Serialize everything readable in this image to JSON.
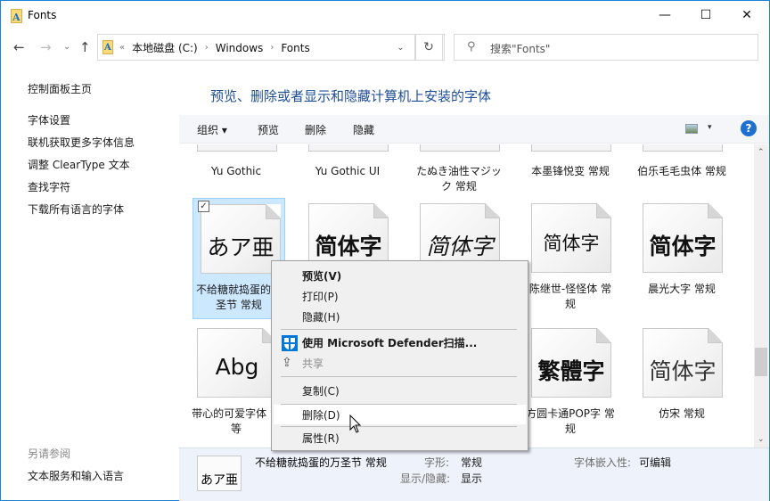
{
  "window": {
    "title": "Fonts",
    "controls": {
      "minimize": "—",
      "maximize": "☐",
      "close": "✕"
    }
  },
  "nav": {
    "back": "←",
    "forward": "→",
    "recent": "⌄",
    "up": "↑",
    "breadcrumb_overflow": "«",
    "breadcrumbs": [
      "本地磁盘 (C:)",
      "Windows",
      "Fonts"
    ],
    "separator": "›",
    "dropdown": "⌄",
    "refresh": "↻",
    "search_placeholder": "搜索\"Fonts\"",
    "search_icon": "⚲"
  },
  "sidebar": {
    "home": "控制面板主页",
    "items": [
      "字体设置",
      "联机获取更多字体信息",
      "调整 ClearType 文本",
      "查找字符",
      "下载所有语言的字体"
    ],
    "see_also_title": "另请参阅",
    "see_also": [
      "文本服务和输入语言"
    ]
  },
  "main": {
    "heading": "预览、删除或者显示和隐藏计算机上安装的字体"
  },
  "toolbar": {
    "organize": "组织 ▾",
    "preview": "预览",
    "delete": "删除",
    "hide": "隐藏",
    "view_dropdown": "▾",
    "help": "?"
  },
  "fonts_row_top": [
    {
      "name": "Yu Gothic"
    },
    {
      "name": "Yu Gothic UI"
    },
    {
      "name": "たぬき油性マジック 常规"
    },
    {
      "name": "本墨锋悦变 常规"
    },
    {
      "name": "伯乐毛毛虫体 常规"
    }
  ],
  "fonts_row_mid": [
    {
      "name": "不给糖就捣蛋的万圣节 常规",
      "sample": "あア亜",
      "selected": true
    },
    {
      "name": "",
      "sample": "简体字"
    },
    {
      "name": "",
      "sample": "简体字"
    },
    {
      "name": "陈继世-怪怪体 常规",
      "sample": "简体字"
    },
    {
      "name": "晨光大字 常规",
      "sample": "简体字"
    }
  ],
  "fonts_row_bot": [
    {
      "name": "带心的可爱字体 中等",
      "sample": "Abg"
    },
    {
      "name": "",
      "sample": ""
    },
    {
      "name": "",
      "sample": ""
    },
    {
      "name": "方圆卡通POP字 常规",
      "sample": "繁體字"
    },
    {
      "name": "仿宋 常规",
      "sample": "简体字"
    }
  ],
  "checkbox_mark": "✓",
  "context_menu": {
    "items": [
      {
        "label": "预览(V)",
        "bold": true
      },
      {
        "label": "打印(P)"
      },
      {
        "label": "隐藏(H)"
      },
      {
        "label": "使用 Microsoft Defender扫描...",
        "bold": true,
        "icon": "defender-shield-icon"
      },
      {
        "label": "共享",
        "disabled": true,
        "icon": "share-icon"
      },
      {
        "label": "复制(C)"
      },
      {
        "label": "删除(D)",
        "hover": true
      },
      {
        "label": "属性(R)"
      }
    ]
  },
  "details": {
    "sample": "あア亜",
    "name": "不给糖就捣蛋的万圣节 常规",
    "style_label": "字形:",
    "style_value": "常规",
    "visibility_label": "显示/隐藏:",
    "visibility_value": "显示",
    "embed_label": "字体嵌入性:",
    "embed_value": "可编辑"
  },
  "scrollbar": {
    "up": "⌃",
    "down": "⌄",
    "position_fraction": 0.72
  }
}
